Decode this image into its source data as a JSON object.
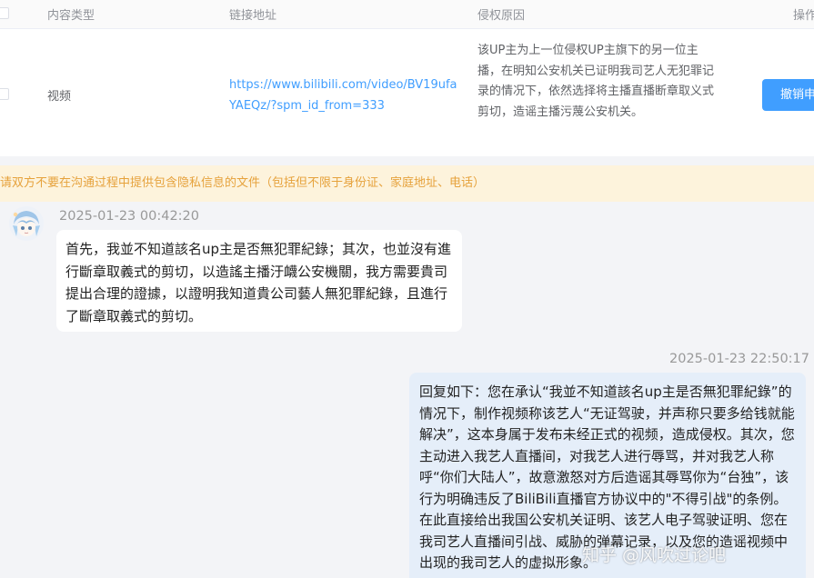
{
  "table": {
    "headers": [
      "内容类型",
      "链接地址",
      "侵权原因",
      "操作"
    ],
    "row": {
      "type": "视频",
      "link": "https://www.bilibili.com/video/BV19ufaYAEQz/?spm_id_from=333",
      "reason": "该UP主为上一位侵权UP主旗下的另一位主播，在明知公安机关已证明我司艺人无犯罪记录的情况下，依然选择将主播直播断章取义式剪切，造谣主播污蔑公安机关。",
      "action": "撤销申"
    }
  },
  "notice": "请双方不要在沟通过程中提供包含隐私信息的文件（包括但不限于身份证、家庭地址、电话）",
  "messages": [
    {
      "time": "2025-01-23 00:42:20",
      "text": "首先，我並不知道該名up主是否無犯罪紀錄；其次，也並沒有進行斷章取義式的剪切，以造謠主播汙衊公安機關，我方需要貴司提出合理的證據，以證明我知道貴公司藝人無犯罪紀錄，且進行了斷章取義式的剪切。"
    },
    {
      "time": "2025-01-23 22:50:17",
      "text": "回复如下：您在承认“我並不知道該名up主是否無犯罪紀錄”的情况下，制作视频称该艺人“无证驾驶，并声称只要多给钱就能解决”，这本身属于发布未经正式的视频，造成侵权。其次，您主动进入我艺人直播间，对我艺人进行辱骂，并对我艺人称呼“你们大陆人”，故意激怒对方后造谣其辱骂你为“台独”，该行为明确违反了BiliBili直播官方协议中的\"不得引战\"的条例。在此直接给出我国公安机关证明、该艺人电子驾驶证明、您在我司艺人直播间引战、威胁的弹幕记录，以及您的造谣视频中出现的我司艺人的虚拟形象。"
    }
  ],
  "watermark": "知乎 @风吹过论吧"
}
